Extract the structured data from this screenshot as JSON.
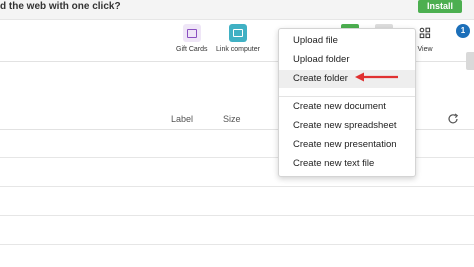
{
  "banner": {
    "text": "d the web with one click?",
    "install_label": "Install"
  },
  "toolbar": {
    "gift_cards_label": "Gift Cards",
    "link_computer_label": "Link computer",
    "view_label": "View",
    "notification_count": "1"
  },
  "list": {
    "columns": {
      "label": "Label",
      "size": "Size"
    }
  },
  "menu": {
    "items": [
      {
        "label": "Upload file"
      },
      {
        "label": "Upload folder"
      },
      {
        "label": "Create folder"
      },
      {
        "label": "Create new document"
      },
      {
        "label": "Create new spreadsheet"
      },
      {
        "label": "Create new presentation"
      },
      {
        "label": "Create new text file"
      }
    ],
    "highlighted_index": 2,
    "annotation_arrow_color": "#e03131"
  },
  "colors": {
    "accent_green": "#4caf50",
    "notif_blue": "#1c6fb9",
    "link_teal": "#40b1c4"
  }
}
